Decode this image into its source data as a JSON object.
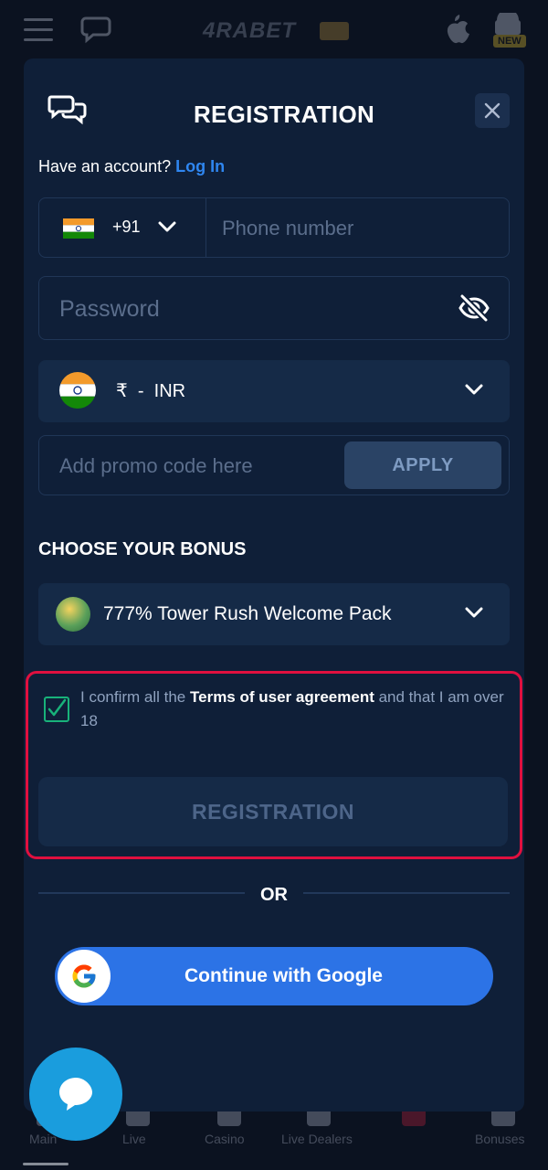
{
  "header": {
    "logo_text": "4RABET",
    "new_badge": "NEW"
  },
  "modal": {
    "title": "REGISTRATION",
    "have_account": "Have an account?",
    "login_link": "Log In",
    "phone": {
      "country_code": "+91",
      "placeholder": "Phone number"
    },
    "password": {
      "placeholder": "Password"
    },
    "currency": {
      "symbol": "₹",
      "separator": "-",
      "code": "INR"
    },
    "promo": {
      "placeholder": "Add promo code here",
      "apply_label": "APPLY"
    },
    "bonus": {
      "heading": "CHOOSE YOUR BONUS",
      "selected": "777% Tower Rush Welcome Pack"
    },
    "terms": {
      "prefix": "I confirm all the ",
      "link": "Terms of user agreement",
      "suffix": " and that I am over 18",
      "checked": true
    },
    "register_label": "REGISTRATION",
    "or_label": "OR",
    "google_label": "Continue with Google"
  },
  "bottom_nav": {
    "items": [
      "Main",
      "Live",
      "Casino",
      "Live Dealers",
      "Bonuses"
    ]
  },
  "colors": {
    "modal_bg": "#0f1f38",
    "accent_blue": "#2f86f0",
    "highlight_red": "#e0103f",
    "google_blue": "#2c73e6",
    "chat_fab": "#1a9ddd"
  }
}
